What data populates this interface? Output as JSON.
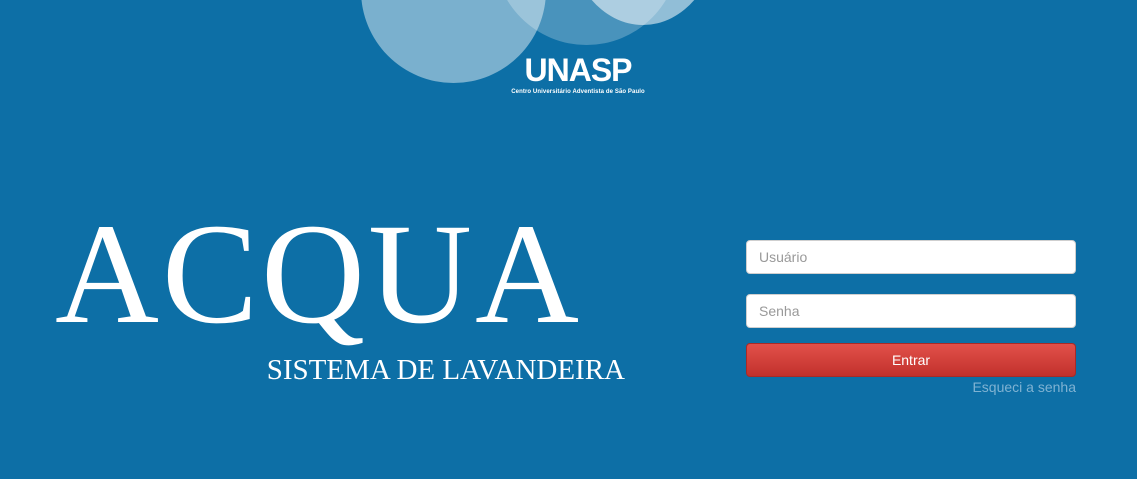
{
  "branding": {
    "logo_text": "UNASP",
    "logo_subtitle": "Centro Universitário Adventista de São Paulo"
  },
  "hero": {
    "title": "ACQUA",
    "subtitle": "SISTEMA DE LAVANDEIRA"
  },
  "login": {
    "username_placeholder": "Usuário",
    "username_value": "",
    "password_placeholder": "Senha",
    "password_value": "",
    "submit_label": "Entrar",
    "forgot_label": "Esqueci a senha"
  },
  "colors": {
    "background": "#0d6fa6",
    "button_red": "#d13b36",
    "link": "#7fb2d2"
  }
}
